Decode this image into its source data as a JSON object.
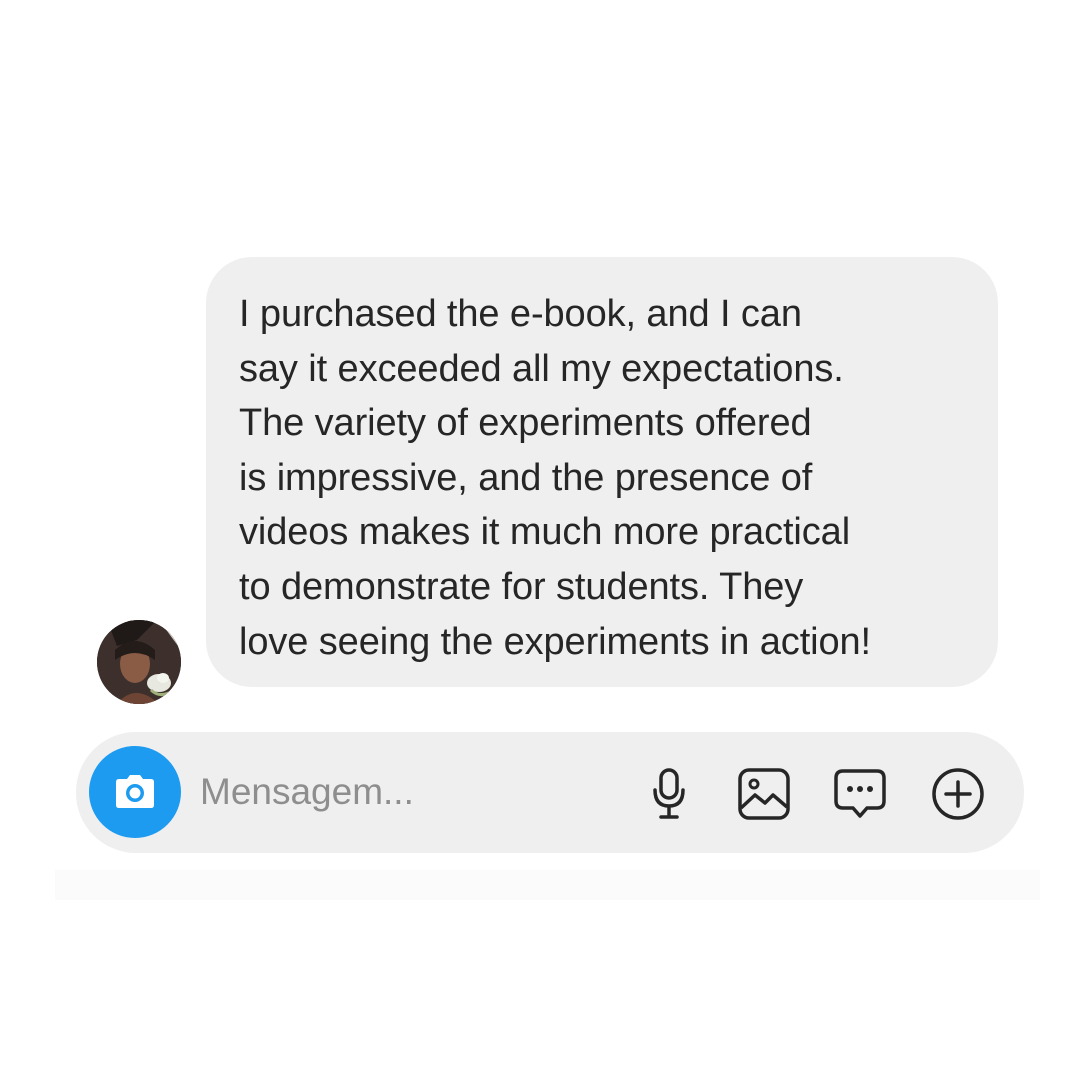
{
  "chat": {
    "avatar_icon": "user-avatar",
    "message": {
      "lines": [
        "I purchased the e-book, and I can",
        "say it exceeded all my expectations.",
        "The variety of experiments offered",
        "is impressive, and the presence of",
        "videos makes it much more practical",
        "to demonstrate for students. They",
        "love seeing the experiments in action!"
      ]
    }
  },
  "composer": {
    "placeholder": "Mensagem...",
    "value": "",
    "icons": {
      "camera": "camera-icon",
      "microphone": "microphone-icon",
      "gallery": "image-icon",
      "sticker": "chat-bubble-dots-icon",
      "more": "plus-circle-icon"
    }
  },
  "colors": {
    "bubble_bg": "#efefef",
    "text": "#262626",
    "placeholder": "#8e8e8e",
    "camera_bg": "#1d9bf0",
    "icon_stroke": "#262626"
  }
}
